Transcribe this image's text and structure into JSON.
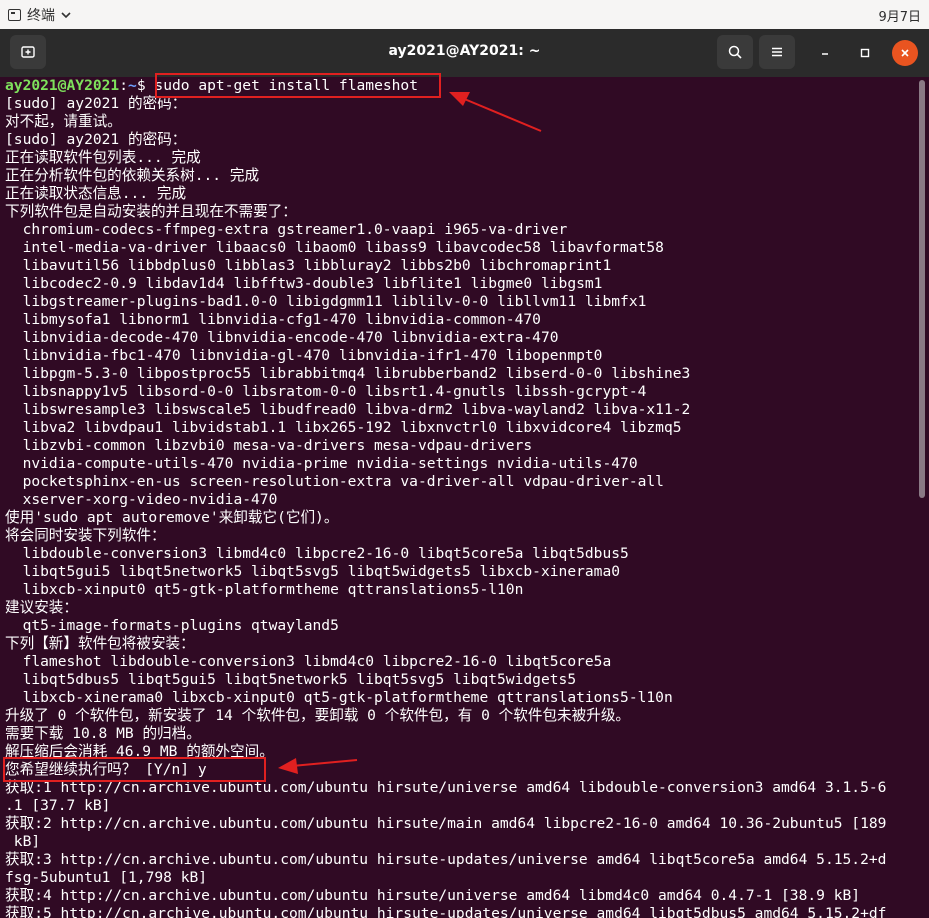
{
  "system_bar": {
    "app_name": "终端",
    "menu_icon": "chevron-down-icon",
    "clock": "9月7日"
  },
  "window": {
    "title": "ay2021@AY2021: ~",
    "new_tab_icon": "new-tab-icon",
    "search_icon": "search-icon",
    "menu_icon": "hamburger-menu-icon",
    "minimize_icon": "minimize-icon",
    "maximize_icon": "maximize-icon",
    "close_icon": "close-icon"
  },
  "colors": {
    "terminal_bg": "#300a24",
    "titlebar_bg": "#2b2b2b",
    "prompt_user": "#7ee15c",
    "prompt_path": "#6e9fff",
    "annotation_red": "#e02020",
    "close_button": "#e95420"
  },
  "terminal": {
    "prompt_user": "ay2021@AY2021",
    "prompt_path": "~",
    "prompt_symbol": "$",
    "command": "sudo apt-get install flameshot",
    "lines": [
      "[sudo] ay2021 的密码：",
      "对不起，请重试。",
      "[sudo] ay2021 的密码：",
      "正在读取软件包列表... 完成",
      "正在分析软件包的依赖关系树... 完成",
      "正在读取状态信息... 完成",
      "下列软件包是自动安装的并且现在不需要了：",
      "  chromium-codecs-ffmpeg-extra gstreamer1.0-vaapi i965-va-driver",
      "  intel-media-va-driver libaacs0 libaom0 libass9 libavcodec58 libavformat58",
      "  libavutil56 libbdplus0 libblas3 libbluray2 libbs2b0 libchromaprint1",
      "  libcodec2-0.9 libdav1d4 libfftw3-double3 libflite1 libgme0 libgsm1",
      "  libgstreamer-plugins-bad1.0-0 libigdgmm11 liblilv-0-0 libllvm11 libmfx1",
      "  libmysofa1 libnorm1 libnvidia-cfg1-470 libnvidia-common-470",
      "  libnvidia-decode-470 libnvidia-encode-470 libnvidia-extra-470",
      "  libnvidia-fbc1-470 libnvidia-gl-470 libnvidia-ifr1-470 libopenmpt0",
      "  libpgm-5.3-0 libpostproc55 librabbitmq4 librubberband2 libserd-0-0 libshine3",
      "  libsnappy1v5 libsord-0-0 libsratom-0-0 libsrt1.4-gnutls libssh-gcrypt-4",
      "  libswresample3 libswscale5 libudfread0 libva-drm2 libva-wayland2 libva-x11-2",
      "  libva2 libvdpau1 libvidstab1.1 libx265-192 libxnvctrl0 libxvidcore4 libzmq5",
      "  libzvbi-common libzvbi0 mesa-va-drivers mesa-vdpau-drivers",
      "  nvidia-compute-utils-470 nvidia-prime nvidia-settings nvidia-utils-470",
      "  pocketsphinx-en-us screen-resolution-extra va-driver-all vdpau-driver-all",
      "  xserver-xorg-video-nvidia-470",
      "使用'sudo apt autoremove'来卸载它(它们)。",
      "将会同时安装下列软件：",
      "  libdouble-conversion3 libmd4c0 libpcre2-16-0 libqt5core5a libqt5dbus5",
      "  libqt5gui5 libqt5network5 libqt5svg5 libqt5widgets5 libxcb-xinerama0",
      "  libxcb-xinput0 qt5-gtk-platformtheme qttranslations5-l10n",
      "建议安装：",
      "  qt5-image-formats-plugins qtwayland5",
      "下列【新】软件包将被安装：",
      "  flameshot libdouble-conversion3 libmd4c0 libpcre2-16-0 libqt5core5a",
      "  libqt5dbus5 libqt5gui5 libqt5network5 libqt5svg5 libqt5widgets5",
      "  libxcb-xinerama0 libxcb-xinput0 qt5-gtk-platformtheme qttranslations5-l10n",
      "升级了 0 个软件包，新安装了 14 个软件包，要卸载 0 个软件包，有 0 个软件包未被升级。",
      "需要下载 10.8 MB 的归档。",
      "解压缩后会消耗 46.9 MB 的额外空间。",
      "您希望继续执行吗？ [Y/n] y",
      "获取:1 http://cn.archive.ubuntu.com/ubuntu hirsute/universe amd64 libdouble-conversion3 amd64 3.1.5-6",
      ".1 [37.7 kB]",
      "获取:2 http://cn.archive.ubuntu.com/ubuntu hirsute/main amd64 libpcre2-16-0 amd64 10.36-2ubuntu5 [189",
      " kB]",
      "获取:3 http://cn.archive.ubuntu.com/ubuntu hirsute-updates/universe amd64 libqt5core5a amd64 5.15.2+d",
      "fsg-5ubuntu1 [1,798 kB]",
      "获取:4 http://cn.archive.ubuntu.com/ubuntu hirsute/universe amd64 libmd4c0 amd64 0.4.7-1 [38.9 kB]",
      "获取:5 http://cn.archive.ubuntu.com/ubuntu hirsute-updates/universe amd64 libqt5dbus5 amd64 5.15.2+df"
    ]
  }
}
